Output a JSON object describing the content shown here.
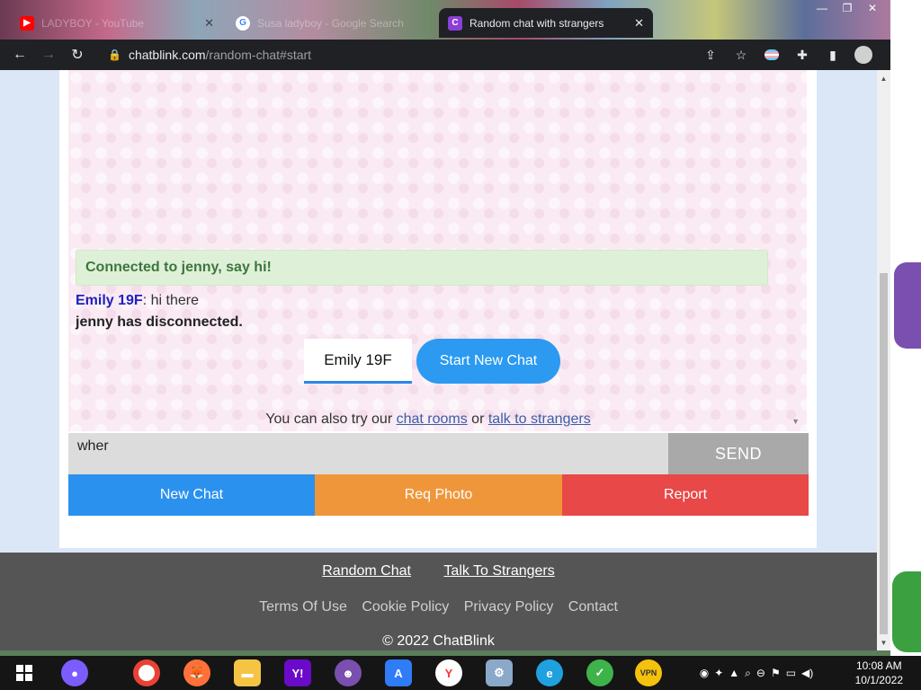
{
  "browser": {
    "tabs": [
      {
        "title": "LADYBOY - YouTube",
        "favicon": "youtube-icon",
        "active": false
      },
      {
        "title": "Susa ladyboy - Google Search",
        "favicon": "google-icon",
        "active": false
      },
      {
        "title": "Random chat with strangers",
        "favicon": "chatblink-icon",
        "active": true
      }
    ],
    "address": {
      "domain": "chatblink.com",
      "path": "/random-chat#start"
    },
    "toolbar_icons": [
      "back-icon",
      "forward-icon",
      "reload-icon",
      "share-icon",
      "bookmark-star-icon",
      "flag-extension-icon",
      "puzzle-extension-icon",
      "side-panel-icon",
      "profile-icon",
      "menu-icon"
    ]
  },
  "chat": {
    "status_banner": "Connected to jenny, say hi!",
    "messages": [
      {
        "author": "Emily 19F",
        "separator": ": ",
        "text": "hi there"
      }
    ],
    "disconnect_notice": "jenny has disconnected.",
    "identity": "Emily 19F",
    "start_new_chat_label": "Start New Chat",
    "alt_prefix": "You can also try our ",
    "alt_link1": "chat rooms",
    "alt_middle": " or ",
    "alt_link2": "talk to strangers",
    "input_value": "wher",
    "send_label": "SEND",
    "actions": {
      "new_chat": "New Chat",
      "req_photo": "Req Photo",
      "report": "Report"
    }
  },
  "footer": {
    "nav": [
      "Random Chat",
      "Talk To Strangers"
    ],
    "links": [
      "Terms Of Use",
      "Cookie Policy",
      "Privacy Policy",
      "Contact"
    ],
    "copyright": "© 2022 ChatBlink"
  },
  "taskbar": {
    "apps": [
      "windows-start-icon",
      "alice-icon",
      "chrome-icon",
      "firefox-icon",
      "file-explorer-icon",
      "yahoo-messenger-icon",
      "bonzi-buddy-icon",
      "launcher-icon",
      "yandex-browser-icon",
      "installer-icon",
      "edge-icon",
      "green-app-icon",
      "vpn-pro-icon"
    ],
    "clock_time": "10:08 AM",
    "clock_date": "10/1/2022"
  },
  "colors": {
    "accent_blue": "#2b91ef",
    "orange": "#f0963a",
    "red": "#e84848",
    "success_green": "#3c763d",
    "chat_bg": "#f9eaf3"
  }
}
